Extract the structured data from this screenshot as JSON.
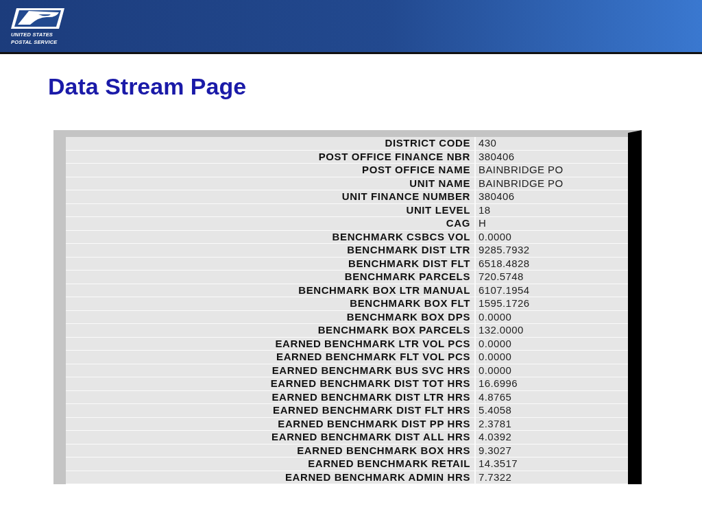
{
  "header": {
    "logo_lines": [
      "UNITED STATES",
      "POSTAL SERVICE"
    ]
  },
  "title": "Data Stream Page",
  "table": {
    "rows": [
      {
        "label": "DISTRICT CODE",
        "value": "430"
      },
      {
        "label": "POST OFFICE FINANCE NBR",
        "value": "380406"
      },
      {
        "label": "POST OFFICE NAME",
        "value": "BAINBRIDGE PO"
      },
      {
        "label": "UNIT NAME",
        "value": "BAINBRIDGE PO"
      },
      {
        "label": "UNIT FINANCE NUMBER",
        "value": "380406"
      },
      {
        "label": "UNIT LEVEL",
        "value": "18"
      },
      {
        "label": "CAG",
        "value": "H"
      },
      {
        "label": "BENCHMARK CSBCS VOL",
        "value": "0.0000"
      },
      {
        "label": "BENCHMARK DIST LTR",
        "value": "9285.7932"
      },
      {
        "label": "BENCHMARK DIST FLT",
        "value": "6518.4828"
      },
      {
        "label": "BENCHMARK PARCELS",
        "value": "720.5748"
      },
      {
        "label": "BENCHMARK BOX LTR MANUAL",
        "value": "6107.1954"
      },
      {
        "label": "BENCHMARK BOX FLT",
        "value": "1595.1726"
      },
      {
        "label": "BENCHMARK BOX DPS",
        "value": "0.0000"
      },
      {
        "label": "BENCHMARK BOX PARCELS",
        "value": "132.0000"
      },
      {
        "label": "EARNED BENCHMARK LTR VOL PCS",
        "value": "0.0000"
      },
      {
        "label": "EARNED BENCHMARK FLT VOL PCS",
        "value": "0.0000"
      },
      {
        "label": "EARNED BENCHMARK BUS SVC HRS",
        "value": "0.0000"
      },
      {
        "label": "EARNED BENCHMARK DIST TOT HRS",
        "value": "16.6996"
      },
      {
        "label": "EARNED BENCHMARK DIST LTR HRS",
        "value": "4.8765"
      },
      {
        "label": "EARNED BENCHMARK DIST FLT HRS",
        "value": "5.4058"
      },
      {
        "label": "EARNED BENCHMARK DIST PP HRS",
        "value": "2.3781"
      },
      {
        "label": "EARNED BENCHMARK DIST ALL HRS",
        "value": "4.0392"
      },
      {
        "label": "EARNED BENCHMARK BOX HRS",
        "value": "9.3027"
      },
      {
        "label": "EARNED BENCHMARK RETAIL",
        "value": "14.3517"
      },
      {
        "label": "EARNED BENCHMARK ADMIN HRS",
        "value": "7.7322"
      }
    ]
  }
}
